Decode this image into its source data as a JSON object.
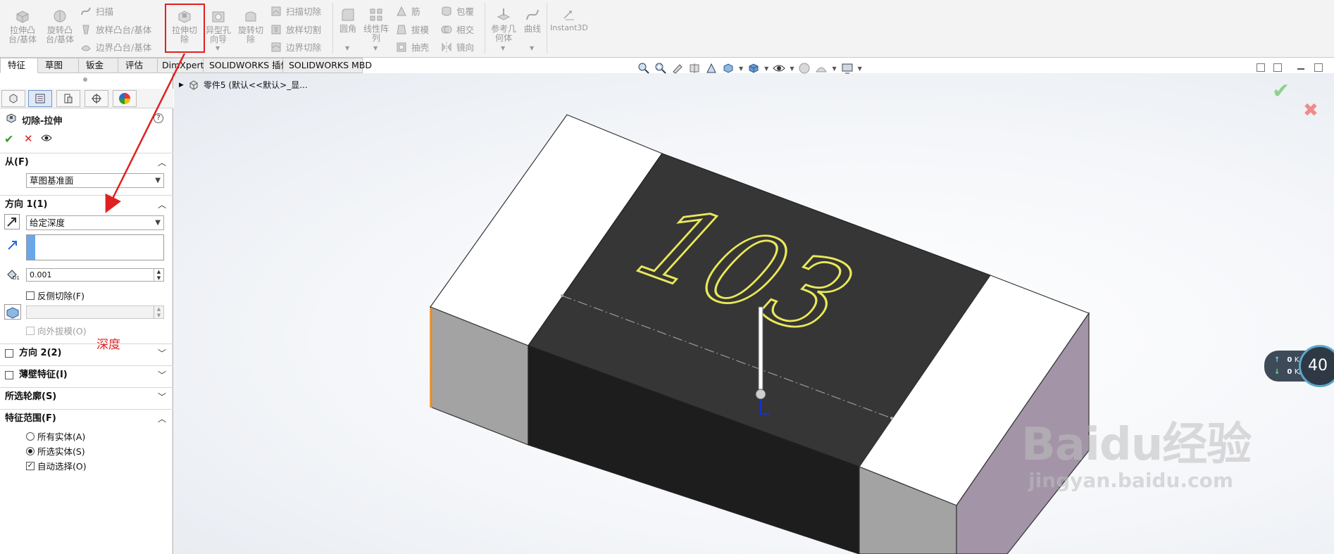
{
  "ribbon": {
    "group1": {
      "extrude_boss": "拉伸凸\n台/基体",
      "revolve_boss": "旋转凸\n台/基体",
      "sweep": "扫描",
      "loft_boss": "放样凸台/基体",
      "boundary_boss": "边界凸台/基体"
    },
    "group2": {
      "extrude_cut": "拉伸切\n除",
      "hole_wizard": "异型孔\n向导",
      "revolve_cut": "旋转切\n除",
      "sweep_cut": "扫描切除",
      "loft_cut": "放样切割",
      "boundary_cut": "边界切除"
    },
    "group3": {
      "fillet": "圆角",
      "linear_pattern": "线性阵\n列",
      "rib": "筋",
      "draft": "拔模",
      "shell": "抽壳",
      "wrap": "包覆",
      "intersect": "相交",
      "mirror": "镜向"
    },
    "group4": {
      "ref_geometry": "参考几\n何体",
      "curves": "曲线",
      "instant3d": "Instant3D"
    }
  },
  "tabs": [
    {
      "label": "特征",
      "active": true
    },
    {
      "label": "草图",
      "active": false
    },
    {
      "label": "钣金",
      "active": false
    },
    {
      "label": "评估",
      "active": false
    },
    {
      "label": "DimXpert",
      "active": false
    },
    {
      "label": "SOLIDWORKS 插件",
      "active": false
    },
    {
      "label": "SOLIDWORKS MBD",
      "active": false
    }
  ],
  "panel": {
    "title": "切除-拉伸",
    "help": "?",
    "from": {
      "header": "从(F)",
      "value": "草图基准面"
    },
    "direction1": {
      "header": "方向 1(1)",
      "end_condition": "给定深度",
      "depth_value": "0.001",
      "flip_side": "反侧切除(F)",
      "draft_outward": "向外拔模(O)",
      "annotation": "深度"
    },
    "direction2": "方向 2(2)",
    "thin_feature": "薄壁特征(I)",
    "selected_contours": "所选轮廓(S)",
    "feature_scope": {
      "header": "特征范围(F)",
      "all_bodies": "所有实体(A)",
      "selected_bodies": "所选实体(S)",
      "auto_select": "自动选择(O)"
    },
    "d1_label": "D1"
  },
  "viewport": {
    "tree_item": "零件5 (默认<<默认>_显...",
    "engraving": "103",
    "network": {
      "up": "0",
      "down": "0",
      "unit": "K/s",
      "gauge": "40"
    },
    "watermark": "Baidu经验",
    "watermark_url": "jingyan.baidu.com"
  },
  "colors": {
    "highlight": "#e02020",
    "accept": "#2e9e2e",
    "cancel": "#d62020",
    "body_dark": "#363636",
    "text_yellow": "#e9e85a"
  }
}
